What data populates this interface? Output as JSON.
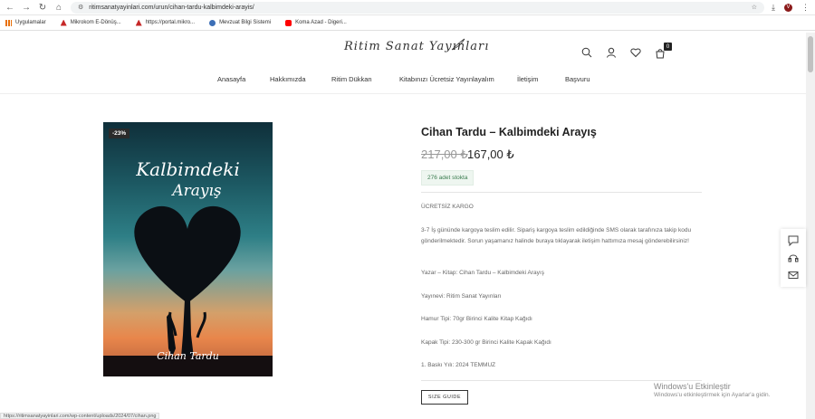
{
  "browser": {
    "url": "ritimsanatyayinlari.com/urun/cihan-tardu-kalbimdeki-arayis/",
    "profile_initial": "V",
    "bookmarks": [
      {
        "label": "Uygulamalar",
        "color": "#e8710a"
      },
      {
        "label": "Mikrokom E-Dönüş...",
        "color": "#c62828"
      },
      {
        "label": "https://portal.mikro...",
        "color": "#c62828"
      },
      {
        "label": "Mevzuat Bilgi Sistemi",
        "color": "#3d6fb6"
      },
      {
        "label": "Koma Azad - Digeri...",
        "color": "#ff0000"
      }
    ]
  },
  "site": {
    "logo": "Ritim Sanat Yayınları",
    "cart_count": "0",
    "nav": [
      "Anasayfa",
      "Hakkımızda",
      "Ritim Dükkan",
      "Kitabınızı Ücretsiz Yayınlayalım",
      "İletişim",
      "Başvuru"
    ]
  },
  "product": {
    "discount": "-23%",
    "cover_title_1": "Kalbimdeki",
    "cover_title_2": "Arayış",
    "cover_author": "Cihan Tardu",
    "title": "Cihan Tardu – Kalbimdeki Arayış",
    "old_price": "217,00 ₺",
    "new_price": "167,00 ₺",
    "stock": "276 adet stokta",
    "desc": [
      "ÜCRETSİZ KARGO",
      "3-7 İş gününde kargoya teslim edilir. Sipariş kargoya teslim edildiğinde SMS olarak tarafınıza takip kodu gönderilmektedir. Sorun yaşamanız halinde buraya tıklayarak  iletişim hattımıza mesaj gönderebilirsiniz!",
      "Yazar – Kitap: Cihan Tardu – Kalbimdeki Arayış",
      "Yayınevi: Ritim Sanat Yayınları",
      "Hamur Tipi: 70gr Birinci Kalite Kitap Kağıdı",
      "Kapak Tipi: 230-300 gr Birinci Kalite Kapak Kağıdı",
      "1. Baskı Yılı: 2024 TEMMUZ"
    ],
    "size_guide": "SIZE GUIDE"
  },
  "windows": {
    "line1": "Windows'u Etkinleştir",
    "line2": "Windows'u etkinleştirmek için Ayarlar'a gidin."
  },
  "status_url": "https://ritimsanatyayinlari.com/wp-content/uploads/2024/07/cihan.png"
}
